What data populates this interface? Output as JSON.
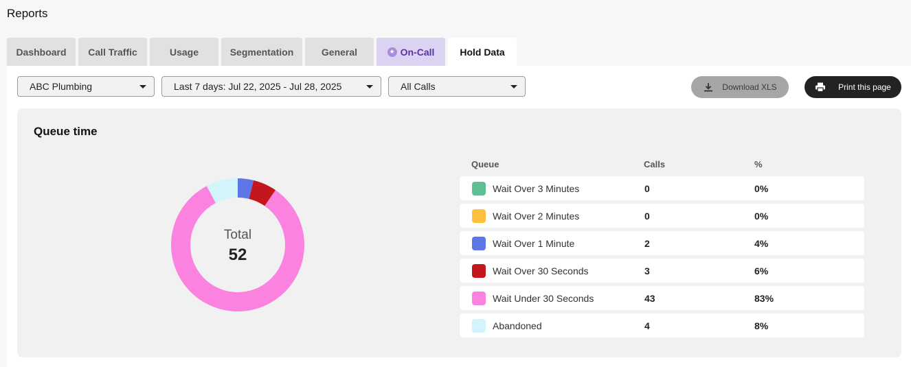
{
  "page": {
    "title": "Reports"
  },
  "tabs": [
    {
      "label": "Dashboard"
    },
    {
      "label": "Call Traffic"
    },
    {
      "label": "Usage"
    },
    {
      "label": "Segmentation"
    },
    {
      "label": "General"
    },
    {
      "label": "On-Call",
      "icon": "star-icon",
      "accent": "#5a32a3"
    },
    {
      "label": "Hold Data",
      "active": true
    }
  ],
  "filters": {
    "account": "ABC Plumbing",
    "date_range": "Last 7 days: Jul 22, 2025 - Jul 28, 2025",
    "call_type": "All Calls"
  },
  "actions": {
    "download_label": "Download XLS",
    "download_icon": "download-icon",
    "print_label": "Print this page",
    "print_icon": "printer-icon"
  },
  "card": {
    "title": "Queue time",
    "total_label": "Total",
    "total_value": "52"
  },
  "table": {
    "headers": {
      "queue": "Queue",
      "calls": "Calls",
      "pct": "%"
    },
    "rows": [
      {
        "name": "Wait Over 3 Minutes",
        "calls": "0",
        "pct": "0%",
        "color": "#5dbf92"
      },
      {
        "name": "Wait Over 2 Minutes",
        "calls": "0",
        "pct": "0%",
        "color": "#ffbf3f"
      },
      {
        "name": "Wait Over 1 Minute",
        "calls": "2",
        "pct": "4%",
        "color": "#5f76e6"
      },
      {
        "name": "Wait Over 30 Seconds",
        "calls": "3",
        "pct": "6%",
        "color": "#c4171d"
      },
      {
        "name": "Wait Under 30 Seconds",
        "calls": "43",
        "pct": "83%",
        "color": "#fb82df"
      },
      {
        "name": "Abandoned",
        "calls": "4",
        "pct": "8%",
        "color": "#d2f5fb"
      }
    ]
  },
  "chart_data": {
    "type": "pie",
    "hole": true,
    "categories": [
      "Wait Over 3 Minutes",
      "Wait Over 2 Minutes",
      "Wait Over 1 Minute",
      "Wait Over 30 Seconds",
      "Wait Under 30 Seconds",
      "Abandoned"
    ],
    "values": [
      0,
      0,
      2,
      3,
      43,
      4
    ],
    "colors": [
      "#5dbf92",
      "#ffbf3f",
      "#5f76e6",
      "#c4171d",
      "#fb82df",
      "#d2f5fb"
    ]
  }
}
